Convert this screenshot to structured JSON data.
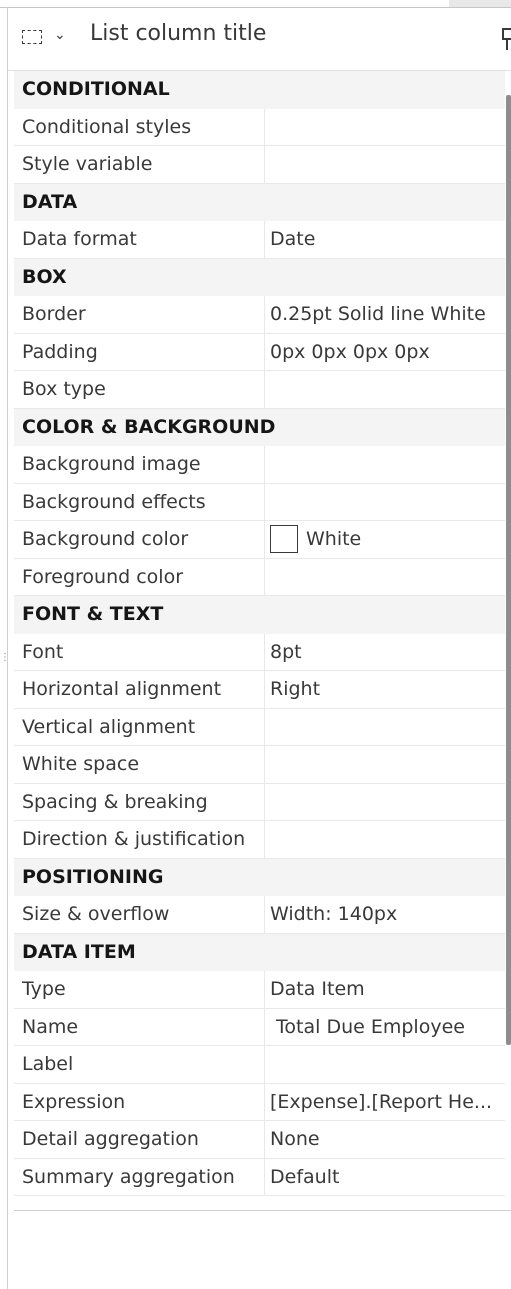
{
  "header": {
    "title": "List column title"
  },
  "properties": [
    {
      "section": "CONDITIONAL",
      "rows": [
        {
          "label": "Conditional styles",
          "value": ""
        },
        {
          "label": "Style variable",
          "value": ""
        }
      ]
    },
    {
      "section": "DATA",
      "rows": [
        {
          "label": "Data format",
          "value": "Date"
        }
      ]
    },
    {
      "section": "BOX",
      "rows": [
        {
          "label": "Border",
          "value": "0.25pt Solid line White"
        },
        {
          "label": "Padding",
          "value": "0px 0px 0px 0px"
        },
        {
          "label": "Box type",
          "value": ""
        }
      ]
    },
    {
      "section": "COLOR & BACKGROUND",
      "rows": [
        {
          "label": "Background image",
          "value": ""
        },
        {
          "label": "Background effects",
          "value": ""
        },
        {
          "label": "Background color",
          "value": "White",
          "swatch": "#ffffff"
        },
        {
          "label": "Foreground color",
          "value": ""
        }
      ]
    },
    {
      "section": "FONT & TEXT",
      "rows": [
        {
          "label": "Font",
          "value": "8pt"
        },
        {
          "label": "Horizontal alignment",
          "value": "Right"
        },
        {
          "label": "Vertical alignment",
          "value": ""
        },
        {
          "label": "White space",
          "value": ""
        },
        {
          "label": "Spacing & breaking",
          "value": ""
        },
        {
          "label": "Direction & justification",
          "value": ""
        }
      ]
    },
    {
      "section": "POSITIONING",
      "rows": [
        {
          "label": "Size & overflow",
          "value": "Width: 140px"
        }
      ]
    },
    {
      "section": "DATA ITEM",
      "rows": [
        {
          "label": "Type",
          "value": "Data Item"
        },
        {
          "label": "Name",
          "value": " Total Due Employee"
        },
        {
          "label": "Label",
          "value": ""
        },
        {
          "label": "Expression",
          "value": "[Expense].[Report He..."
        },
        {
          "label": "Detail aggregation",
          "value": "None"
        },
        {
          "label": "Summary aggregation",
          "value": "Default"
        }
      ]
    }
  ]
}
